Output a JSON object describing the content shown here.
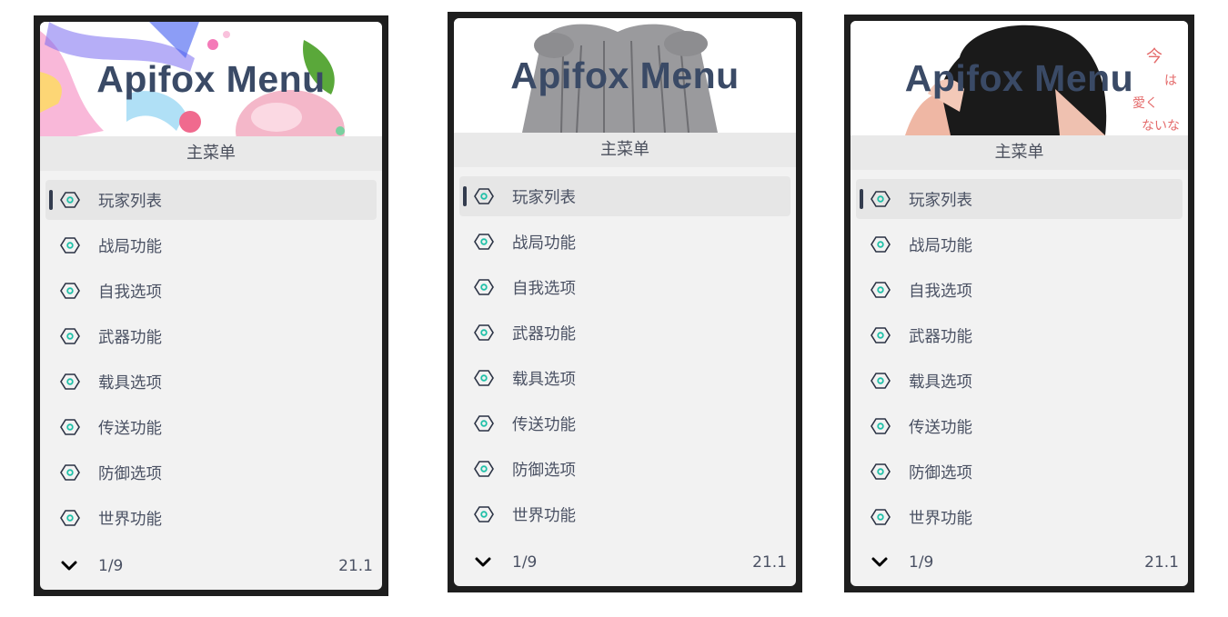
{
  "panels": [
    {
      "title": "Apifox Menu",
      "subheader": "主菜单",
      "items": [
        "玩家列表",
        "战局功能",
        "自我选项",
        "武器功能",
        "载具选项",
        "传送功能",
        "防御选项",
        "世界功能"
      ],
      "pager": "1/9",
      "version": "21.1"
    },
    {
      "title": "Apifox Menu",
      "subheader": "主菜单",
      "items": [
        "玩家列表",
        "战局功能",
        "自我选项",
        "武器功能",
        "载具选项",
        "传送功能",
        "防御选项",
        "世界功能"
      ],
      "pager": "1/9",
      "version": "21.1"
    },
    {
      "title": "Apifox Menu",
      "subheader": "主菜单",
      "items": [
        "玩家列表",
        "战局功能",
        "自我选项",
        "武器功能",
        "载具选项",
        "传送功能",
        "防御选项",
        "世界功能"
      ],
      "pager": "1/9",
      "version": "21.1"
    }
  ],
  "icons": {
    "menu_item": "hexagon-nut-icon",
    "footer": "chevron-down-icon"
  },
  "colors": {
    "title": "#3a4a66",
    "icon_outline": "#2b3344",
    "icon_accent": "#1fc0a8",
    "frame": "#1e1e1e",
    "panel": "#f2f2f2"
  }
}
